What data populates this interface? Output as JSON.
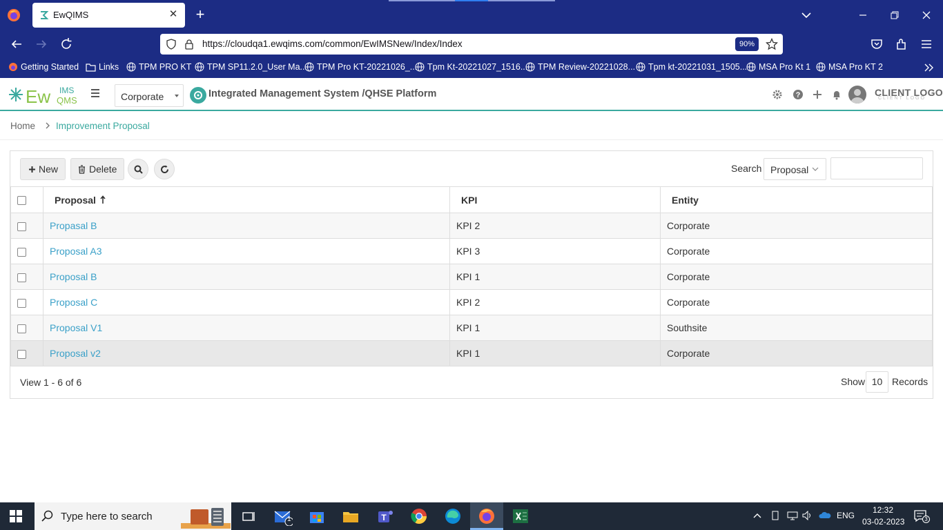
{
  "browser": {
    "tab_title": "EwQIMS",
    "url": "https://cloudqa1.ewqims.com/common/EwIMSNew/Index/Index",
    "zoom": "90%",
    "bookmarks": [
      "Getting Started",
      "Links",
      "TPM PRO KT",
      "TPM SP11.2.0_User Ma...",
      "TPM Pro KT-20221026_...",
      "Tpm Kt-20221027_1516...",
      "TPM Review-20221028...",
      "Tpm kt-20221031_1505...",
      "MSA Pro Kt 1",
      "MSA Pro KT 2"
    ]
  },
  "app": {
    "entity_selected": "Corporate",
    "title": "Integrated Management System /QHSE Platform",
    "client_logo": "CLIENT LOGO",
    "client_logo_sub": "CLIENT LOGO",
    "colors": {
      "accent": "#3aa99f",
      "link": "#3aa0c8",
      "chrome": "#1c2c84"
    }
  },
  "breadcrumb": {
    "home": "Home",
    "current": "Improvement Proposal"
  },
  "toolbar": {
    "new_label": "New",
    "delete_label": "Delete",
    "search_label": "Search",
    "search_field": "Proposal",
    "search_value": ""
  },
  "table": {
    "columns": [
      "Proposal",
      "KPI",
      "Entity"
    ],
    "sort": {
      "column": "Proposal",
      "direction": "ascending"
    },
    "rows": [
      {
        "proposal": "Propasal B",
        "kpi": "KPI 2",
        "entity": "Corporate"
      },
      {
        "proposal": "Proposal A3",
        "kpi": "KPI 3",
        "entity": "Corporate"
      },
      {
        "proposal": "Proposal B",
        "kpi": "KPI 1",
        "entity": "Corporate"
      },
      {
        "proposal": "Proposal C",
        "kpi": "KPI 2",
        "entity": "Corporate"
      },
      {
        "proposal": "Proposal V1",
        "kpi": "KPI 1",
        "entity": "Southsite"
      },
      {
        "proposal": "Proposal v2",
        "kpi": "KPI 1",
        "entity": "Corporate"
      }
    ]
  },
  "footer": {
    "view_text": "View 1 - 6 of 6",
    "show_label": "Show",
    "page_size": "10",
    "records_label": "Records"
  },
  "taskbar": {
    "search_placeholder": "Type here to search",
    "mail_badge": "1",
    "language": "ENG",
    "time": "12:32",
    "date": "03-02-2023",
    "notification_count": "3"
  }
}
